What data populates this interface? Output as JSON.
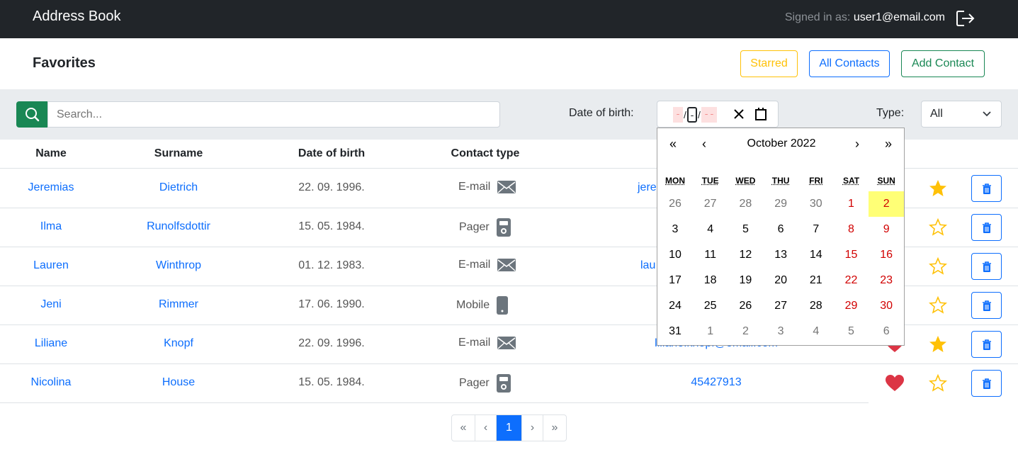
{
  "navbar": {
    "brand": "Address Book",
    "signed_in_label": "Signed in as:",
    "user_email": "user1@email.com",
    "logout_icon": "logout-icon"
  },
  "header": {
    "title": "Favorites",
    "starred_label": "Starred",
    "all_contacts_label": "All Contacts",
    "add_contact_label": "Add Contact"
  },
  "filters": {
    "search_placeholder": "Search...",
    "dob_label": "Date of birth:",
    "date_day": "--",
    "date_month": "--",
    "date_year": "----",
    "type_label": "Type:",
    "type_value": "All"
  },
  "table": {
    "headers": [
      "Name",
      "Surname",
      "Date of birth",
      "Contact type"
    ],
    "rows": [
      {
        "name": "Jeremias",
        "surname": "Dietrich",
        "dob": "22. 09. 1996.",
        "type": "E-mail",
        "contact": "jere",
        "favorite": false,
        "starred": true
      },
      {
        "name": "Ilma",
        "surname": "Runolfsdottir",
        "dob": "15. 05. 1984.",
        "type": "Pager",
        "contact": "",
        "favorite": false,
        "starred": false
      },
      {
        "name": "Lauren",
        "surname": "Winthrop",
        "dob": "01. 12. 1983.",
        "type": "E-mail",
        "contact": "lau",
        "favorite": false,
        "starred": false
      },
      {
        "name": "Jeni",
        "surname": "Rimmer",
        "dob": "17. 06. 1990.",
        "type": "Mobile",
        "contact": "",
        "favorite": false,
        "starred": false
      },
      {
        "name": "Liliane",
        "surname": "Knopf",
        "dob": "22. 09. 1996.",
        "type": "E-mail",
        "contact": "liliane.knopf@email.com",
        "favorite": true,
        "starred": true
      },
      {
        "name": "Nicolina",
        "surname": "House",
        "dob": "15. 05. 1984.",
        "type": "Pager",
        "contact": "45427913",
        "favorite": true,
        "starred": false
      }
    ]
  },
  "pagination": {
    "first": "«",
    "prev": "‹",
    "current": "1",
    "next": "›",
    "last": "»"
  },
  "calendar": {
    "prev_year": "«",
    "prev_month": "‹",
    "title": "October 2022",
    "next_month": "›",
    "next_year": "»",
    "weekdays": [
      "MON",
      "TUE",
      "WED",
      "THU",
      "FRI",
      "SAT",
      "SUN"
    ],
    "weeks": [
      [
        "26",
        "27",
        "28",
        "29",
        "30",
        "1",
        "2"
      ],
      [
        "3",
        "4",
        "5",
        "6",
        "7",
        "8",
        "9"
      ],
      [
        "10",
        "11",
        "12",
        "13",
        "14",
        "15",
        "16"
      ],
      [
        "17",
        "18",
        "19",
        "20",
        "21",
        "22",
        "23"
      ],
      [
        "24",
        "25",
        "26",
        "27",
        "28",
        "29",
        "30"
      ],
      [
        "31",
        "1",
        "2",
        "3",
        "4",
        "5",
        "6"
      ]
    ],
    "today": "2"
  },
  "colors": {
    "navbar": "#212529",
    "primary": "#0d6efd",
    "success": "#198754",
    "warning": "#ffc107",
    "danger": "#dc3545"
  }
}
